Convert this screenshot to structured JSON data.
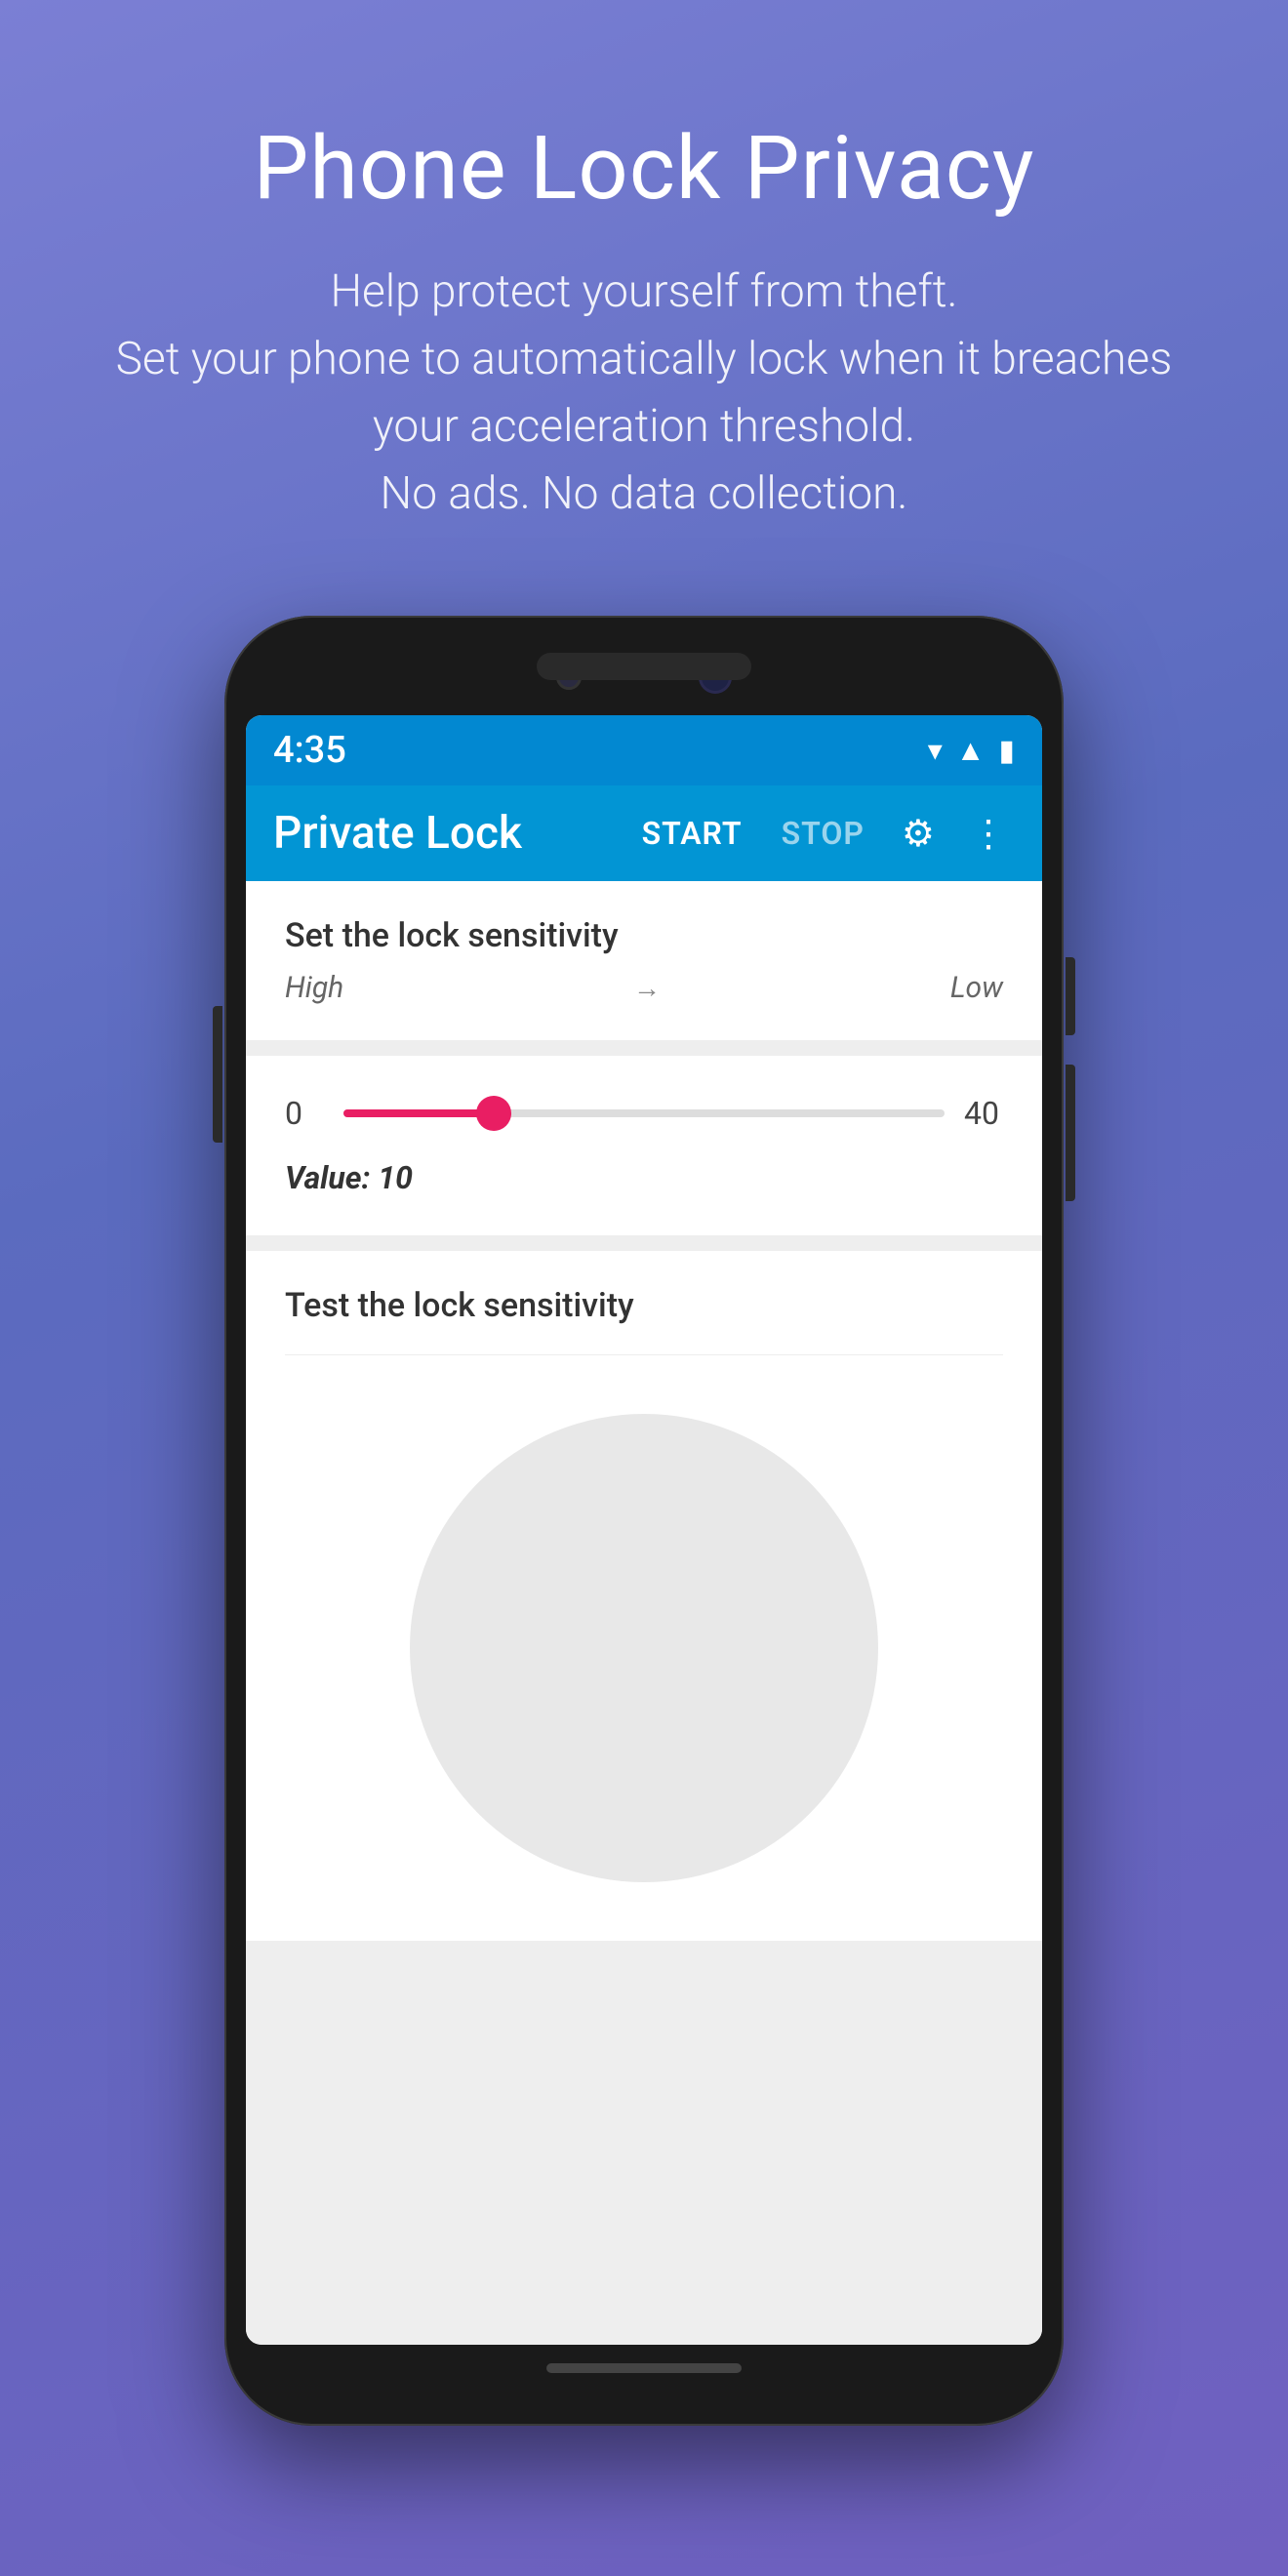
{
  "header": {
    "title": "Phone Lock Privacy",
    "description_line1": "Help protect yourself from theft.",
    "description_line2": "Set your phone to automatically lock when it breaches",
    "description_line3": "your acceleration threshold.",
    "description_line4": "No ads. No data collection."
  },
  "phone": {
    "status_bar": {
      "time": "4:35",
      "icons": [
        "wifi",
        "signal",
        "battery"
      ]
    },
    "toolbar": {
      "app_name": "Private Lock",
      "start_btn": "START",
      "stop_btn": "STOP"
    },
    "sensitivity_section": {
      "title": "Set the lock sensitivity",
      "label_high": "High",
      "arrow": "→",
      "label_low": "Low"
    },
    "slider": {
      "min": "0",
      "max": "40",
      "value_label": "Value: 10",
      "current_value": 10,
      "fill_percent": 25
    },
    "test_section": {
      "title": "Test the lock sensitivity"
    }
  }
}
